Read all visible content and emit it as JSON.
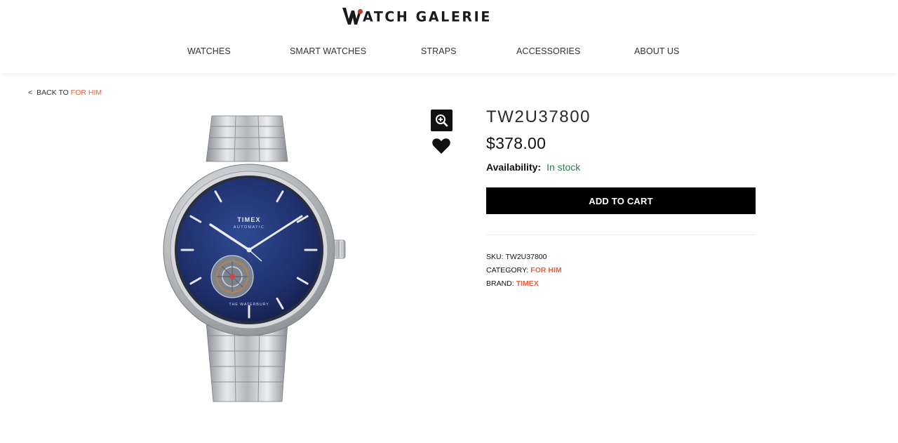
{
  "header": {
    "brand_text": "ATCH GALERIE",
    "logo_letter": "W",
    "nav": [
      {
        "label": "WATCHES"
      },
      {
        "label": "SMART WATCHES"
      },
      {
        "label": "STRAPS"
      },
      {
        "label": "ACCESSORIES"
      },
      {
        "label": "ABOUT US"
      }
    ]
  },
  "breadcrumb": {
    "chevron": "<",
    "prefix": "BACK TO",
    "link": "FOR HIM"
  },
  "gallery": {
    "zoom_icon": "zoom-in-icon",
    "wishlist_icon": "heart-icon",
    "dial_brand": "TIMEX",
    "dial_sub": "AUTOMATIC",
    "dial_model": "THE WATERBURY"
  },
  "product": {
    "title": "TW2U37800",
    "price": "$378.00",
    "availability_label": "Availability:",
    "availability_value": "In stock",
    "add_to_cart": "ADD TO CART",
    "sku_label": "SKU:",
    "sku_value": "TW2U37800",
    "category_label": "CATEGORY:",
    "category_value": "FOR HIM",
    "brand_label": "BRAND:",
    "brand_value": "TIMEX"
  },
  "colors": {
    "accent": "#e8603c",
    "in_stock": "#2c7d4c",
    "button_bg": "#000000",
    "dial": "#1f2f6b"
  }
}
